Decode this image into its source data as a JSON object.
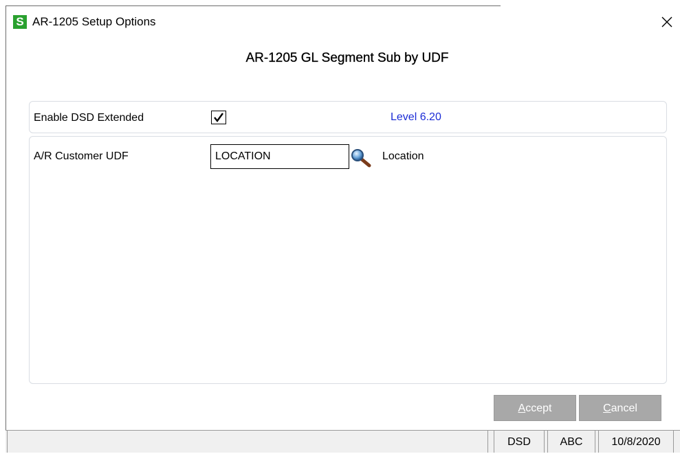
{
  "window": {
    "title": "AR-1205 Setup Options",
    "app_icon_letter": "S",
    "app_icon_color": "#2aa12f",
    "close_icon": "close-icon"
  },
  "form": {
    "heading": "AR-1205 GL Segment Sub by UDF",
    "enable_label": "Enable DSD Extended",
    "enable_checked": true,
    "level_text": "Level 6.20",
    "level_color": "#1a2bd6",
    "udf_label": "A/R Customer UDF",
    "udf_value": "LOCATION",
    "udf_description": "Location",
    "lookup_icon": "magnifier-icon"
  },
  "buttons": {
    "accept_hotkey": "A",
    "accept_rest": "ccept",
    "cancel_hotkey": "C",
    "cancel_rest": "ancel"
  },
  "statusbar": {
    "main": "",
    "module": "DSD",
    "company": "ABC",
    "date": "10/8/2020"
  }
}
